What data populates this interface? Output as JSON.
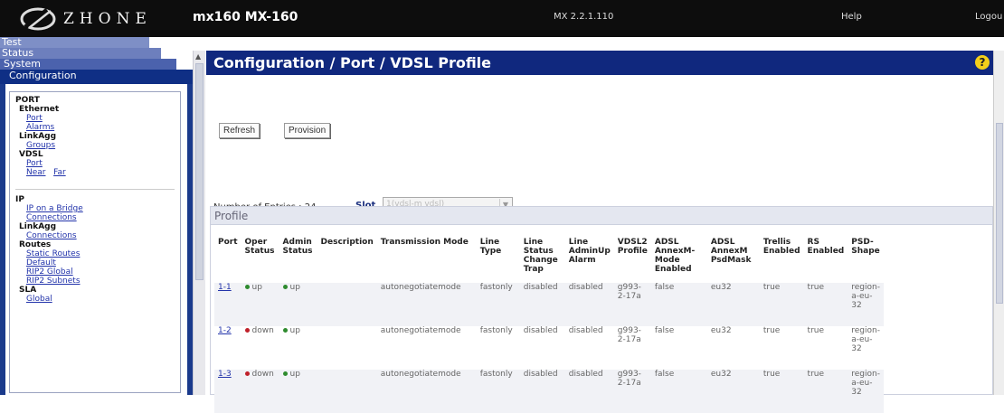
{
  "header": {
    "logo_text": "ZHONE",
    "device_name": "mx160 MX-160",
    "version": "MX 2.2.1.110",
    "help": "Help",
    "logout": "Logou"
  },
  "nav": {
    "tabs": [
      "Test",
      "Status",
      "System",
      "Configuration"
    ],
    "port": {
      "title": "PORT",
      "ethernet": "Ethernet",
      "ethernet_links": [
        "Port",
        "Alarms"
      ],
      "linkagg": "LinkAgg",
      "linkagg_links": [
        "Groups"
      ],
      "vdsl": "VDSL",
      "vdsl_links": [
        "Port",
        "Near",
        "Far"
      ]
    },
    "ip": {
      "title": "IP",
      "links1": [
        "IP on a Bridge",
        "Connections"
      ],
      "linkagg": "LinkAgg",
      "linkagg_links": [
        "Connections"
      ],
      "routes": "Routes",
      "routes_links": [
        "Static Routes",
        "Default",
        "RIP2 Global",
        "RIP2 Subnets"
      ],
      "sla": "SLA",
      "sla_links": [
        "Global"
      ]
    }
  },
  "page": {
    "title": "Configuration / Port / VDSL Profile",
    "help_icon": "?",
    "refresh": "Refresh",
    "provision": "Provision",
    "entries": "Number of Entries : 24",
    "slot_label": "Slot",
    "slot_value": "1(vdsl-m vdsl)",
    "profile_title": "Profile"
  },
  "table": {
    "headers": [
      "Port",
      "Oper Status",
      "Admin Status",
      "Description",
      "Transmission Mode",
      "Line Type",
      "Line Status Change Trap",
      "Line AdminUp Alarm",
      "VDSL2 Profile",
      "ADSL AnnexM-Mode Enabled",
      "ADSL AnnexM PsdMask",
      "Trellis Enabled",
      "RS Enabled",
      "PSD-Shape"
    ],
    "rows": [
      {
        "port": "1-1",
        "oper": "up",
        "oper_color": "#2e8b2e",
        "admin": "up",
        "admin_color": "#2e8b2e",
        "desc": "",
        "mode": "autonegotiatemode",
        "line_type": "fastonly",
        "trap": "disabled",
        "alarm": "disabled",
        "vdsl2": "g993-2-17a",
        "annexm": "false",
        "psdmask": "eu32",
        "trellis": "true",
        "rs": "true",
        "psd": "region-a-eu-32"
      },
      {
        "port": "1-2",
        "oper": "down",
        "oper_color": "#c0202a",
        "admin": "up",
        "admin_color": "#2e8b2e",
        "desc": "",
        "mode": "autonegotiatemode",
        "line_type": "fastonly",
        "trap": "disabled",
        "alarm": "disabled",
        "vdsl2": "g993-2-17a",
        "annexm": "false",
        "psdmask": "eu32",
        "trellis": "true",
        "rs": "true",
        "psd": "region-a-eu-32"
      },
      {
        "port": "1-3",
        "oper": "down",
        "oper_color": "#c0202a",
        "admin": "up",
        "admin_color": "#2e8b2e",
        "desc": "",
        "mode": "autonegotiatemode",
        "line_type": "fastonly",
        "trap": "disabled",
        "alarm": "disabled",
        "vdsl2": "g993-2-17a",
        "annexm": "false",
        "psdmask": "eu32",
        "trellis": "true",
        "rs": "true",
        "psd": "region-a-eu-32"
      }
    ]
  }
}
